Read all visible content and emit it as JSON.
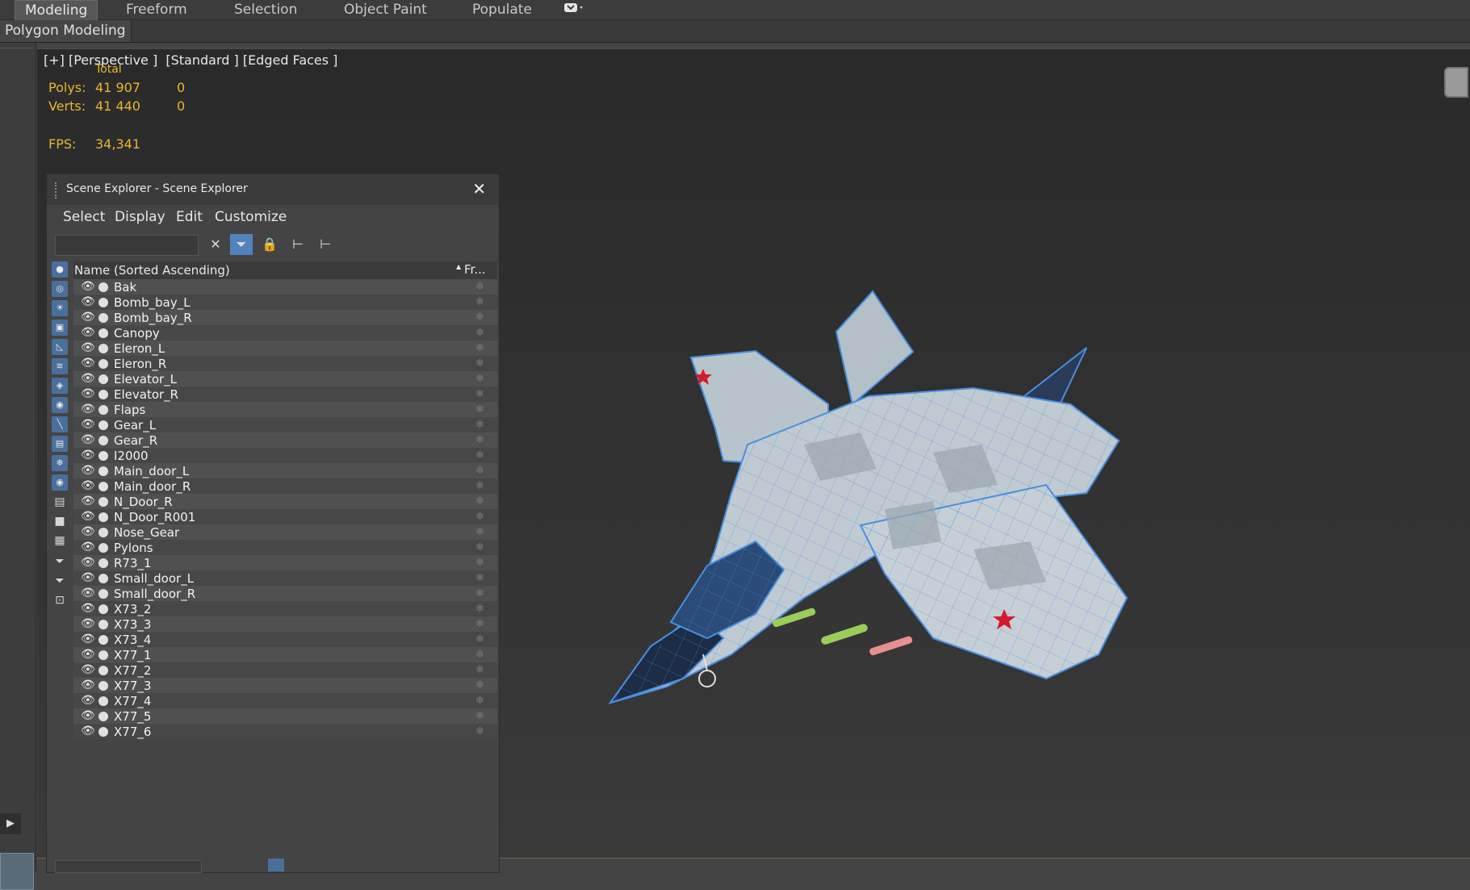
{
  "ribbon_tabs": [
    "Modeling",
    "Freeform",
    "Selection",
    "Object Paint",
    "Populate"
  ],
  "ribbon_extra_icon": "ribbon-options-icon",
  "ribbon_panel_label": "Polygon Modeling",
  "viewport": {
    "label": "[+] [Perspective ]  [Standard ] [Edged Faces ]",
    "stats": {
      "total_label": "Total",
      "polys_label": "Polys:",
      "polys_total": "41 907",
      "polys_selected": "0",
      "verts_label": "Verts:",
      "verts_total": "41 440",
      "verts_selected": "0",
      "fps_label": "FPS:",
      "fps_value": "34,341"
    }
  },
  "scene_explorer": {
    "title": "Scene Explorer - Scene Explorer",
    "menu": [
      "Select",
      "Display",
      "Edit",
      "Customize"
    ],
    "column_name": "Name (Sorted Ascending)",
    "column_freeze": "Fr...",
    "items": [
      "Bak",
      "Bomb_bay_L",
      "Bomb_bay_R",
      "Canopy",
      "Eleron_L",
      "Eleron_R",
      "Elevator_L",
      "Elevator_R",
      "Flaps",
      "Gear_L",
      "Gear_R",
      "I2000",
      "Main_door_L",
      "Main_door_R",
      "N_Door_R",
      "N_Door_R001",
      "Nose_Gear",
      "Pylons",
      "R73_1",
      "Small_door_L",
      "Small_door_R",
      "X73_2",
      "X73_3",
      "X73_4",
      "X77_1",
      "X77_2",
      "X77_3",
      "X77_4",
      "X77_5",
      "X77_6"
    ]
  },
  "colors": {
    "stats_text": "#e6b830",
    "accent_blue": "#5283c0",
    "wireframe": "#4a8fe0"
  }
}
